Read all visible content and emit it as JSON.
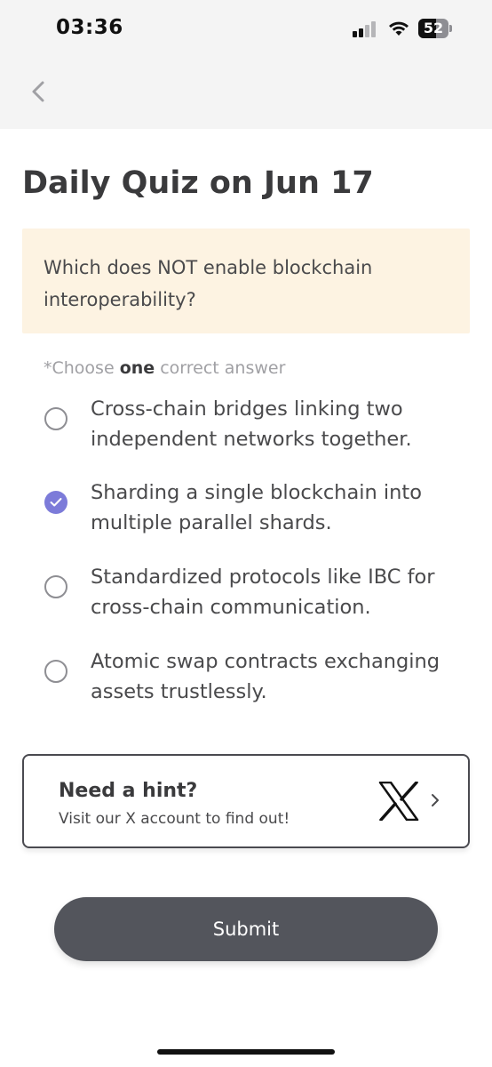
{
  "status_bar": {
    "time": "03:36",
    "battery_level": "52"
  },
  "nav": {
    "back_icon": "chevron-left-icon"
  },
  "quiz": {
    "title": "Daily Quiz on Jun 17",
    "question": "Which does NOT enable blockchain interoperability?",
    "instruction_prefix": "*Choose ",
    "instruction_emphasis": "one",
    "instruction_suffix": " correct answer",
    "options": [
      {
        "label": "Cross-chain bridges linking two independent networks together.",
        "selected": false
      },
      {
        "label": "Sharding a single blockchain into multiple parallel shards.",
        "selected": true
      },
      {
        "label": "Standardized protocols like IBC for cross-chain communication.",
        "selected": false
      },
      {
        "label": "Atomic swap contracts exchanging assets trustlessly.",
        "selected": false
      }
    ]
  },
  "hint": {
    "title": "Need a hint?",
    "subtitle": "Visit our X account to find out!",
    "logo_icon": "x-logo-icon",
    "chevron_icon": "chevron-right-icon"
  },
  "submit": {
    "label": "Submit"
  },
  "colors": {
    "accent": "#7c7bd9",
    "question_bg": "#fdf3e2",
    "button_bg": "#53555c"
  }
}
